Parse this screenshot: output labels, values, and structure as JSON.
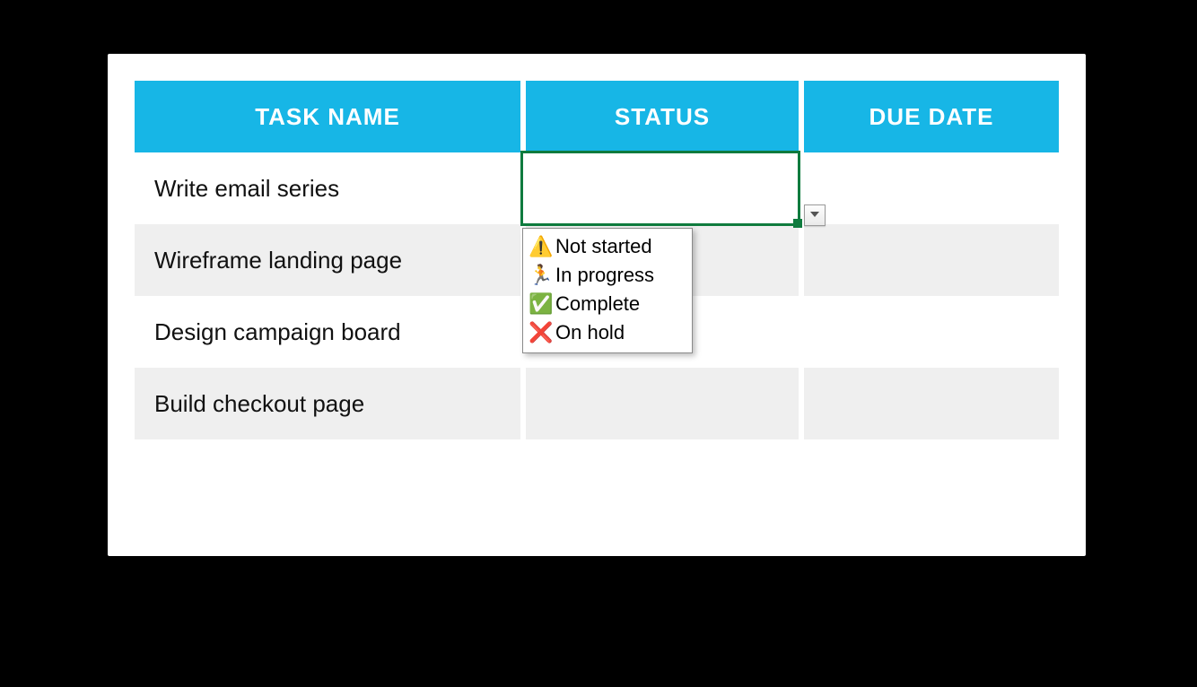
{
  "table": {
    "headers": [
      "TASK NAME",
      "STATUS",
      "DUE DATE"
    ],
    "rows": [
      {
        "task": "Write email series",
        "status": "",
        "due": ""
      },
      {
        "task": "Wireframe landing page",
        "status": "",
        "due": ""
      },
      {
        "task": "Design campaign board",
        "status": "",
        "due": ""
      },
      {
        "task": "Build checkout page",
        "status": "",
        "due": ""
      }
    ]
  },
  "dropdown": {
    "options": [
      {
        "icon": "⚠️",
        "label": "Not started"
      },
      {
        "icon": "🏃",
        "label": "In progress"
      },
      {
        "icon": "✅",
        "label": "Complete"
      },
      {
        "icon": "❌",
        "label": "On hold"
      }
    ]
  },
  "selection": {
    "row": 0,
    "col": 1
  }
}
